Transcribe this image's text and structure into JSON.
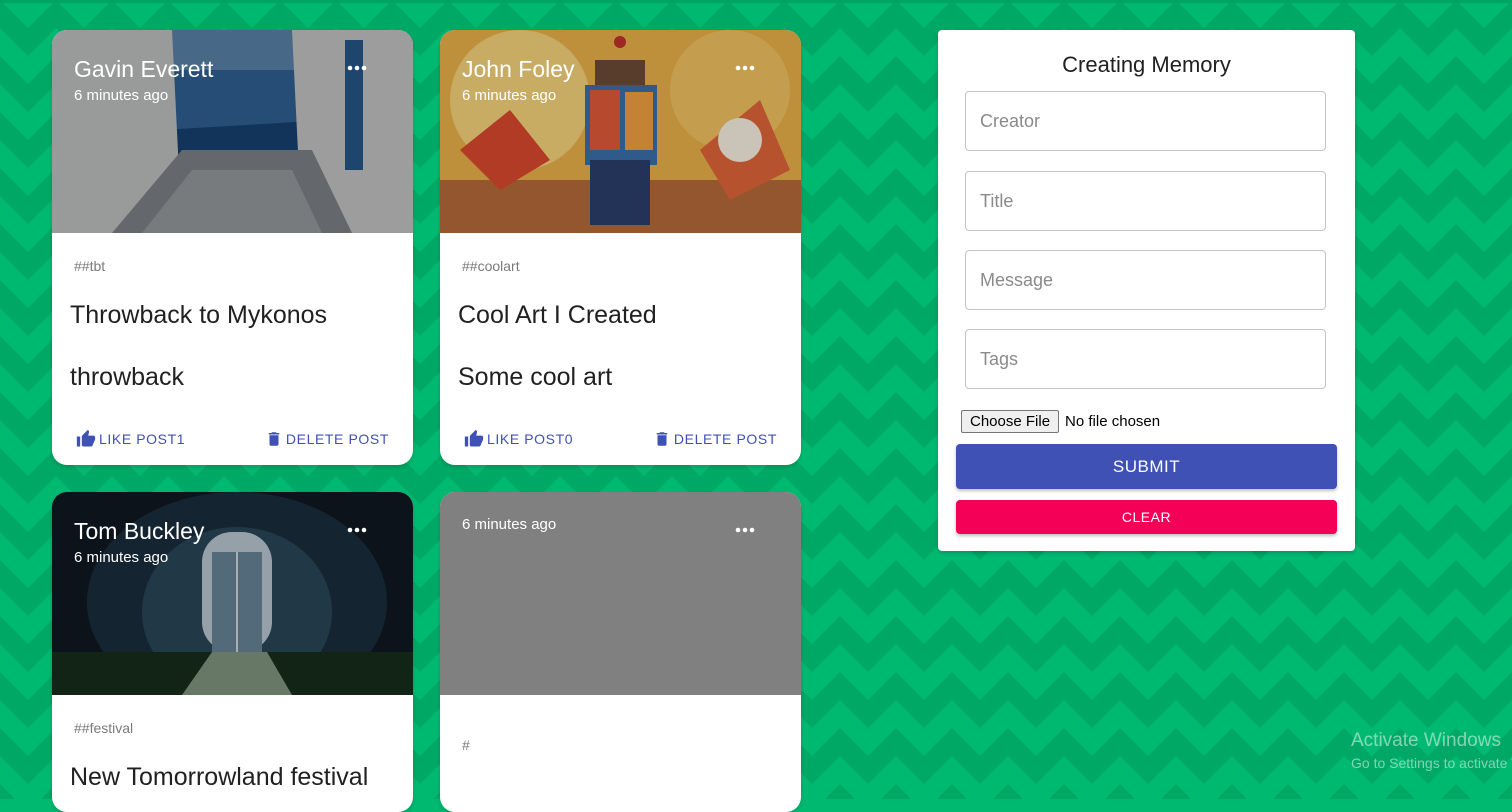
{
  "colors": {
    "background": "#00b971",
    "primary": "#3f51b5",
    "secondary": "#f50057"
  },
  "posts": [
    {
      "creator": "Gavin Everett",
      "time": "6 minutes ago",
      "tags": "##tbt",
      "title": "Throwback to Mykonos",
      "message": "throwback",
      "like_label": "LIKE POST1",
      "delete_label": "DELETE POST",
      "more_icon": "more-horiz-icon"
    },
    {
      "creator": "John Foley",
      "time": "6 minutes ago",
      "tags": "##coolart",
      "title": "Cool Art I Created",
      "message": "Some cool art",
      "like_label": "LIKE POST0",
      "delete_label": "DELETE POST",
      "more_icon": "more-horiz-icon"
    },
    {
      "creator": "Tom Buckley",
      "time": "6 minutes ago",
      "tags": "##festival",
      "title": "New Tomorrowland festival",
      "more_icon": "more-horiz-icon"
    },
    {
      "time": "6 minutes ago",
      "tags": "#",
      "more_icon": "more-horiz-icon"
    }
  ],
  "form": {
    "title": "Creating Memory",
    "creator_placeholder": "Creator",
    "title_placeholder": "Title",
    "message_placeholder": "Message",
    "tags_placeholder": "Tags",
    "file_button": "Choose File",
    "file_status": "No file chosen",
    "submit_label": "SUBMIT",
    "clear_label": "CLEAR"
  },
  "watermark": {
    "line1": "Activate Windows",
    "line2": "Go to Settings to activate Windows."
  }
}
